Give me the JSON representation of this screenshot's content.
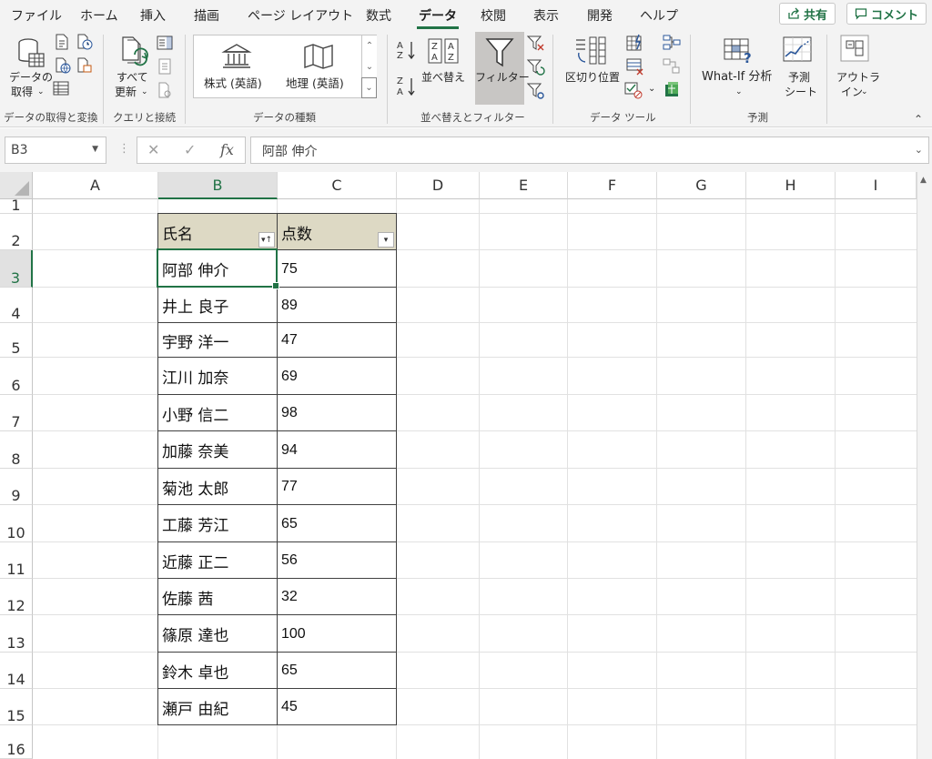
{
  "menu": {
    "tabs": [
      "ファイル",
      "ホーム",
      "挿入",
      "描画",
      "ページ レイアウト",
      "数式",
      "データ",
      "校閲",
      "表示",
      "開発",
      "ヘルプ"
    ],
    "active_tab": "データ",
    "share_label": "共有",
    "comment_label": "コメント"
  },
  "ribbon": {
    "get_data": "データの",
    "get_data2": "取得",
    "refresh": "すべて",
    "refresh2": "更新",
    "stocks": "株式 (英語)",
    "geography": "地理 (英語)",
    "sort": "並べ替え",
    "filter": "フィルター",
    "text_to_columns": "区切り位置",
    "whatif": "What-If 分析",
    "forecast": "予測",
    "forecast2": "シート",
    "outline": "アウトラ",
    "outline2": "イン",
    "groups": {
      "get_transform": "データの取得と変換",
      "queries": "クエリと接続",
      "data_types": "データの種類",
      "sort_filter": "並べ替えとフィルター",
      "data_tools": "データ ツール",
      "forecast": "予測"
    }
  },
  "formula_bar": {
    "name_box": "B3",
    "fx": "fx",
    "content": "阿部 伸介"
  },
  "sheet": {
    "columns": [
      "A",
      "B",
      "C",
      "D",
      "E",
      "F",
      "G",
      "H",
      "I"
    ],
    "rows": [
      "1",
      "2",
      "3",
      "4",
      "5",
      "6",
      "7",
      "8",
      "9",
      "10",
      "11",
      "12",
      "13",
      "14",
      "15",
      "16"
    ],
    "table_headers": [
      "氏名",
      "点数"
    ],
    "table_rows": [
      [
        "阿部 伸介",
        "75"
      ],
      [
        "井上 良子",
        "89"
      ],
      [
        "宇野 洋一",
        "47"
      ],
      [
        "江川 加奈",
        "69"
      ],
      [
        "小野 信二",
        "98"
      ],
      [
        "加藤 奈美",
        "94"
      ],
      [
        "菊池 太郎",
        "77"
      ],
      [
        "工藤 芳江",
        "65"
      ],
      [
        "近藤 正二",
        "56"
      ],
      [
        "佐藤 茜",
        "32"
      ],
      [
        "篠原 達也",
        "100"
      ],
      [
        "鈴木 卓也",
        "65"
      ],
      [
        "瀬戸 由紀",
        "45"
      ]
    ],
    "header_fill": "#ddd9c4",
    "accent": "#217346"
  }
}
